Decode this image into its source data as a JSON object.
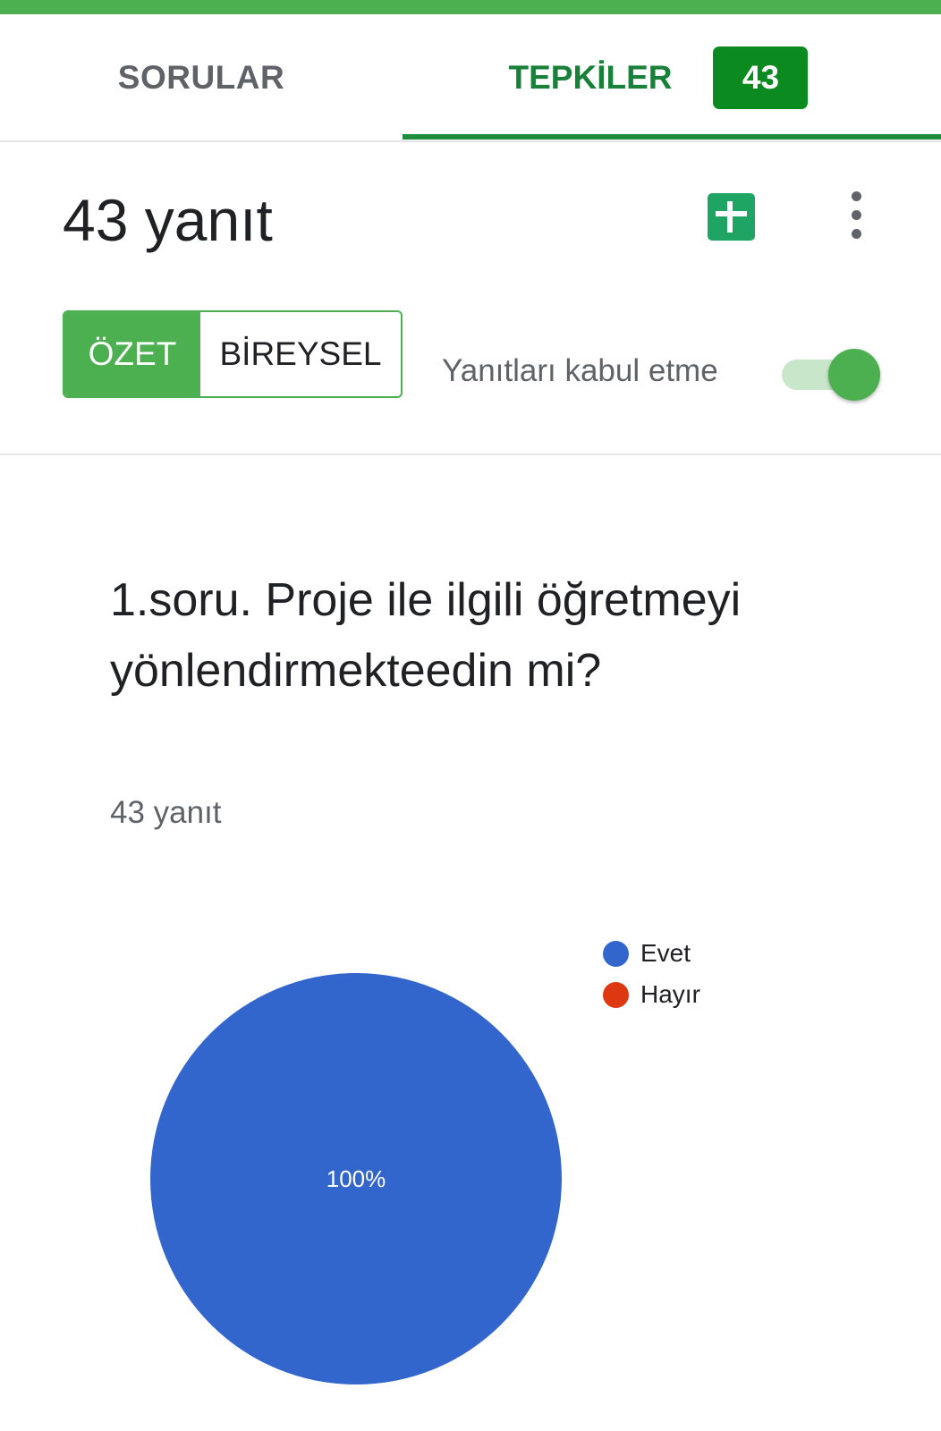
{
  "tabs": {
    "questions_label": "SORULAR",
    "responses_label": "TEPKİLER",
    "responses_count": "43"
  },
  "header": {
    "title": "43 yanıt"
  },
  "view_toggle": {
    "summary_label": "ÖZET",
    "individual_label": "BİREYSEL"
  },
  "accepting": {
    "label": "Yanıtları kabul etme",
    "enabled": true
  },
  "question": {
    "title": "1.soru. Proje ile ilgili öğretmeyi yönlendirmekteedin mi?",
    "response_count": "43 yanıt"
  },
  "colors": {
    "accent": "#4caf50",
    "evet": "#3366cc",
    "hayir": "#dc3912"
  },
  "chart_data": {
    "type": "pie",
    "slices": [
      {
        "name": "Evet",
        "value": 100,
        "label": "100%",
        "color": "#3366cc"
      },
      {
        "name": "Hayır",
        "value": 0,
        "label": "",
        "color": "#dc3912"
      }
    ],
    "legend": [
      "Evet",
      "Hayır"
    ],
    "legend_position": "top-right"
  }
}
